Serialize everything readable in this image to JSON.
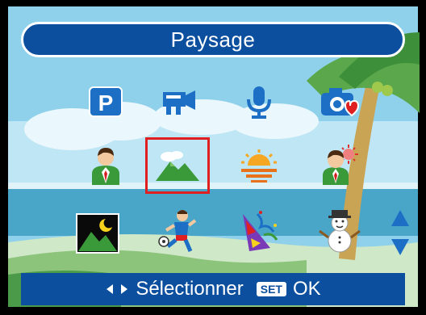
{
  "title": "Paysage",
  "modes": [
    {
      "row": 1,
      "col": 1,
      "icon": "program-mode-icon",
      "glyph": "P"
    },
    {
      "row": 1,
      "col": 2,
      "icon": "video-camera-icon"
    },
    {
      "row": 1,
      "col": 3,
      "icon": "microphone-icon"
    },
    {
      "row": 1,
      "col": 4,
      "icon": "camera-favorite-icon"
    },
    {
      "row": 2,
      "col": 1,
      "icon": "portrait-icon"
    },
    {
      "row": 2,
      "col": 2,
      "icon": "landscape-icon",
      "selected": true
    },
    {
      "row": 2,
      "col": 3,
      "icon": "sunset-icon"
    },
    {
      "row": 2,
      "col": 4,
      "icon": "backlight-portrait-icon"
    },
    {
      "row": 3,
      "col": 1,
      "icon": "night-scene-icon"
    },
    {
      "row": 3,
      "col": 2,
      "icon": "sports-icon"
    },
    {
      "row": 3,
      "col": 3,
      "icon": "party-icon"
    },
    {
      "row": 3,
      "col": 4,
      "icon": "snow-icon"
    }
  ],
  "footer": {
    "select_label": "Sélectionner",
    "set_key": "SET",
    "ok_label": "OK"
  },
  "colors": {
    "bar": "#0b4f9e",
    "selection": "#e02020",
    "sky": "#7fc7e3",
    "sea": "#4aa6c9"
  }
}
